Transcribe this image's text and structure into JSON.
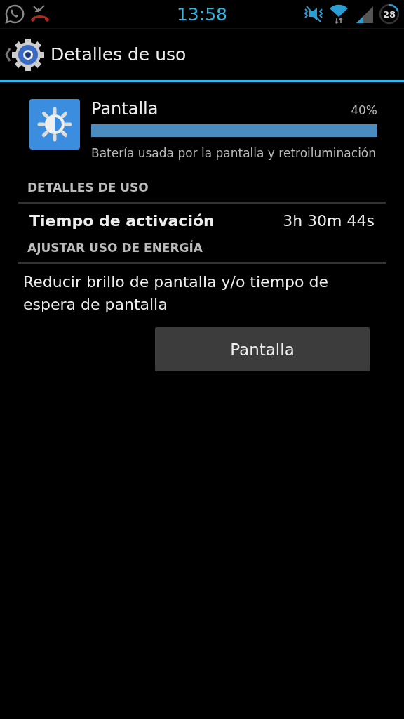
{
  "status_bar": {
    "time": "13:58",
    "battery": "28"
  },
  "action_bar": {
    "title": "Detalles de uso"
  },
  "app": {
    "name": "Pantalla",
    "percent": "40%",
    "level": 1,
    "description": "Batería usada por la pantalla y retroiluminación"
  },
  "sections": [
    {
      "title": "DETALLES DE USO",
      "kind": "detail",
      "label": "Tiempo de activación",
      "value": "3h 30m 44s"
    },
    {
      "title": "AJUSTAR USO DE ENERGÍA",
      "kind": "action",
      "text": "Reducir brillo de pantalla y/o tiempo de espera de pantalla",
      "button": "Pantalla"
    }
  ]
}
